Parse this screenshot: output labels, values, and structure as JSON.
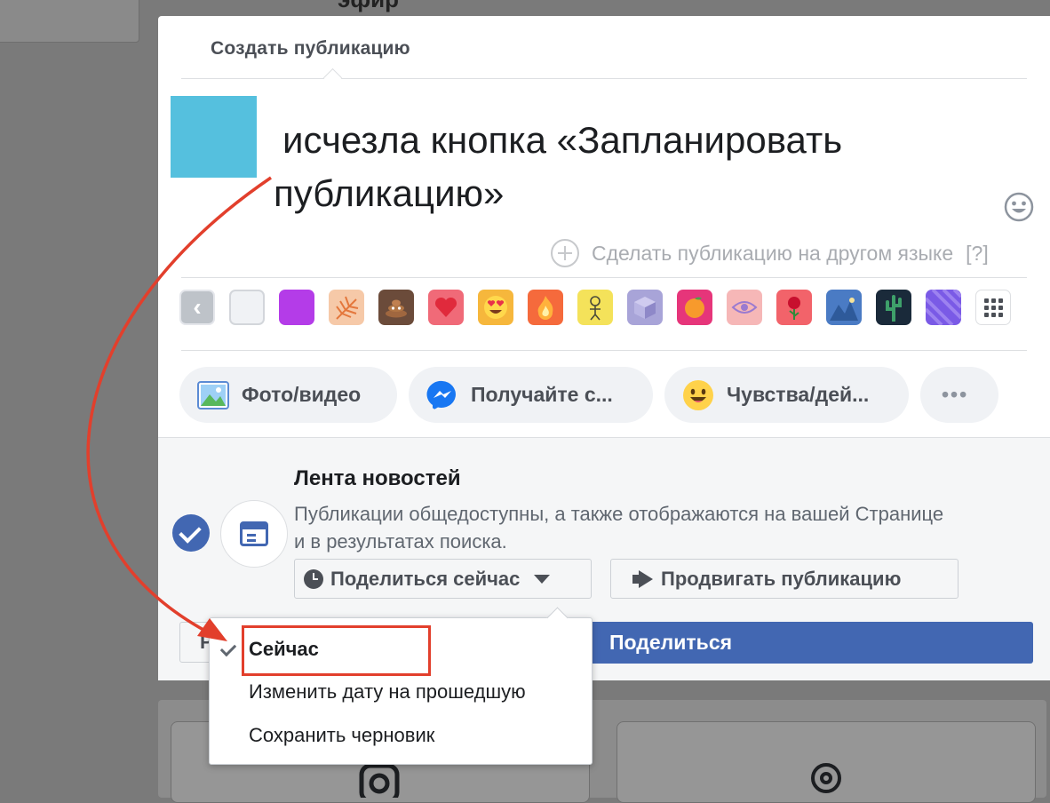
{
  "background": {
    "heading_fragment": "эфир"
  },
  "dialog": {
    "title": "Создать публикацию",
    "post_text_line1": "исчезла кнопка «Запланировать",
    "post_text_line2": "публикацию»",
    "other_language": "Сделать публикацию на другом языке",
    "help_mark": "[?]",
    "backgrounds": [
      {
        "icon": "back-arrow",
        "color": "#bec3c9"
      },
      {
        "icon": "plain-white",
        "color": "#f0f2f5"
      },
      {
        "icon": "purple",
        "color": "#b43ce8"
      },
      {
        "icon": "palm-leaf",
        "color": "#f6c9a8"
      },
      {
        "icon": "poop-emoji",
        "color": "#6b4b3a"
      },
      {
        "icon": "heart",
        "color": "#f06a78"
      },
      {
        "icon": "heart-eyes-emoji",
        "color": "#f6b73c"
      },
      {
        "icon": "fire",
        "color": "#f56a3c"
      },
      {
        "icon": "doodle",
        "color": "#f4e25a"
      },
      {
        "icon": "cube",
        "color": "#a8a4d8"
      },
      {
        "icon": "orange-fruit",
        "color": "#e6357a"
      },
      {
        "icon": "eye",
        "color": "#f6b7b7"
      },
      {
        "icon": "rose",
        "color": "#f2636a"
      },
      {
        "icon": "landscape",
        "color": "#4a7bc4"
      },
      {
        "icon": "cactus",
        "color": "#1a2a3a"
      },
      {
        "icon": "violet-pattern",
        "color": "#7a5ae6"
      },
      {
        "icon": "grid",
        "color": "#ffffff"
      }
    ],
    "actions": [
      {
        "label": "Фото/видео",
        "icon": "photo-icon"
      },
      {
        "label": "Получайте с...",
        "icon": "messenger-icon"
      },
      {
        "label": "Чувства/дей...",
        "icon": "smiley-icon"
      },
      {
        "label": "•••",
        "icon": "more-icon"
      }
    ],
    "feed": {
      "title": "Лента новостей",
      "desc_line1": "Публикации общедоступны, а также отображаются на вашей Странице",
      "desc_line2": "и в результатах поиска."
    },
    "share_now": "Поделиться сейчас",
    "promote": "Продвигать публикацию",
    "left_button_fragment": "Р",
    "share": "Поделиться"
  },
  "dropdown": {
    "items": [
      "Сейчас",
      "Изменить дату на прошедшую",
      "Сохранить черновик"
    ],
    "selected": "Сейчас"
  },
  "colors": {
    "accent": "#4267b2",
    "annotation": "#e23f2c",
    "avatar": "#55c0de"
  }
}
